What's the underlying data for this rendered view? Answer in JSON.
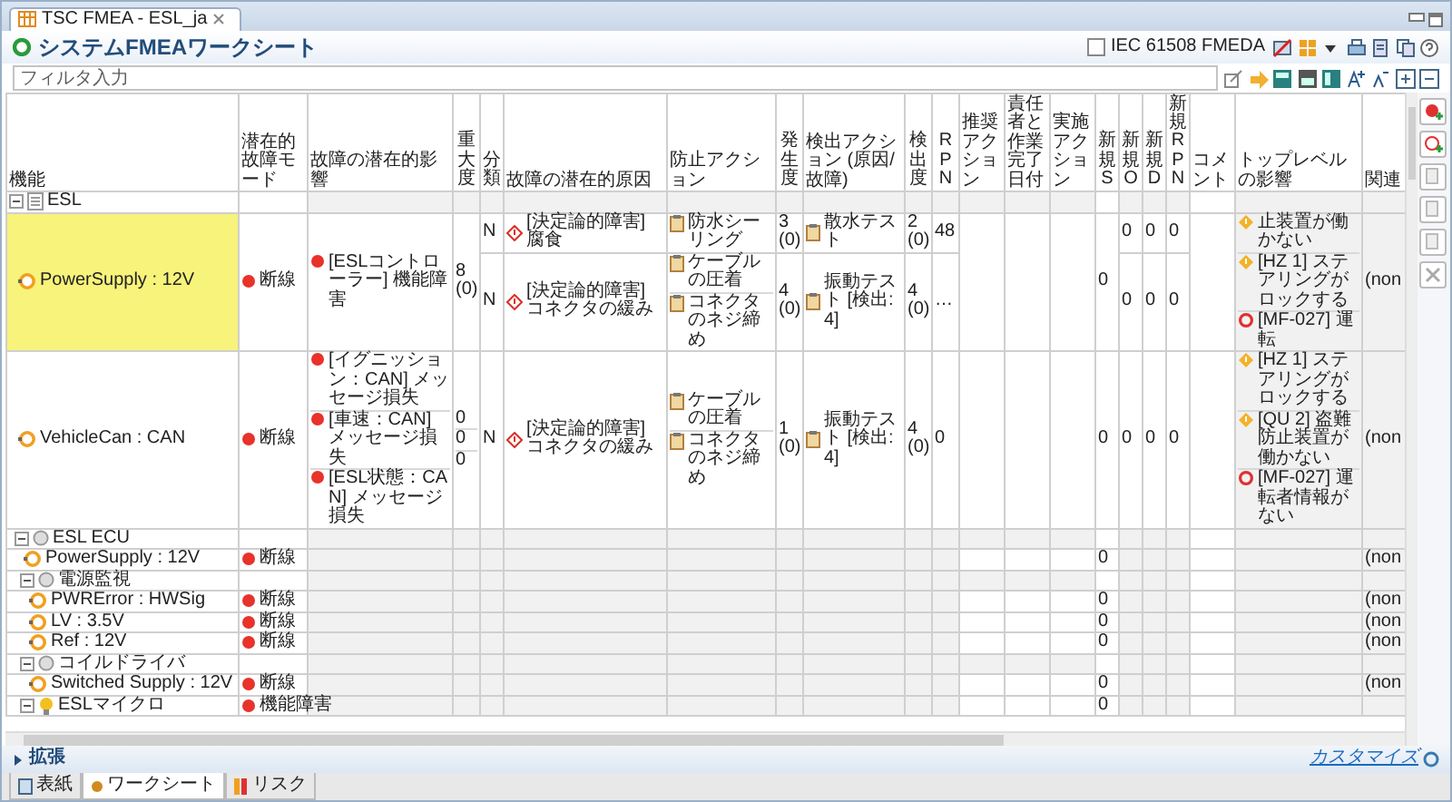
{
  "window": {
    "tab_title": "TSC FMEA - ESL_ja"
  },
  "header": {
    "title": "システムFMEAワークシート",
    "fmeda_checkbox": {
      "label": "IEC 61508 FMEDA",
      "checked": false
    }
  },
  "filter": {
    "placeholder": "フィルタ入力"
  },
  "table": {
    "columns": [
      {
        "label": "機能",
        "kind": "h"
      },
      {
        "label": "潜在的故障モード",
        "kind": "h"
      },
      {
        "label": "故障の潜在的影響",
        "kind": "h"
      },
      {
        "label": "重大度",
        "kind": "v"
      },
      {
        "label": "分類",
        "kind": "v"
      },
      {
        "label": "故障の潜在的原因",
        "kind": "h"
      },
      {
        "label": "防止アクション",
        "kind": "h"
      },
      {
        "label": "発生度",
        "kind": "v"
      },
      {
        "label": "検出アクション (原因/故障)",
        "kind": "h"
      },
      {
        "label": "検出度",
        "kind": "v"
      },
      {
        "label": "RPN",
        "kind": "v"
      },
      {
        "label": "推奨アクション",
        "kind": "h"
      },
      {
        "label": "責任者と作業完了日付",
        "kind": "h"
      },
      {
        "label": "実施アクション",
        "kind": "h"
      },
      {
        "label": "新規S",
        "kind": "v"
      },
      {
        "label": "新規O",
        "kind": "v"
      },
      {
        "label": "新規D",
        "kind": "v"
      },
      {
        "label": "新規RPN",
        "kind": "v"
      },
      {
        "label": "コメント",
        "kind": "h"
      },
      {
        "label": "トップレベルの影響",
        "kind": "h"
      },
      {
        "label": "関連",
        "kind": "h"
      }
    ],
    "rows": [
      {
        "function": "ESL",
        "kind": "system",
        "selected": false,
        "expanded": true,
        "children": [
          {
            "function": "PowerSupply : 12V",
            "kind": "port",
            "selected": true,
            "mode": "断線",
            "effects": [
              {
                "text": "[ESLコントローラー] 機能障害",
                "severity": "8 (0)"
              }
            ],
            "causes": [
              {
                "class": "N",
                "text": "[決定論的障害] 腐食",
                "prevention": [
                  "防水シーリング"
                ],
                "occurrence": "3 (0)",
                "detection": "散水テスト",
                "det_rating": "2 (0)",
                "rpn": "48",
                "new_o": "0",
                "new_d": "0",
                "new_rpn": "0"
              },
              {
                "class": "N",
                "text": "[決定論的障害] コネクタの緩み",
                "prevention": [
                  "ケーブルの圧着",
                  "コネクタのネジ締め"
                ],
                "occurrence": "4 (0)",
                "detection": "振動テスト [検出: 4]",
                "det_rating": "4 (0)",
                "rpn": "…",
                "new_o": "0",
                "new_d": "0",
                "new_rpn": "0"
              }
            ],
            "new_s": "0",
            "top_effects": [
              {
                "text": "止装置が働かない",
                "kind": "hazard"
              },
              {
                "text": "[HZ 1] ステアリングがロックする",
                "kind": "hazard"
              },
              {
                "text": "[MF-027] 運転",
                "kind": "malfunction"
              }
            ],
            "related": "(non"
          },
          {
            "function": "VehicleCan : CAN",
            "kind": "port",
            "selected": false,
            "mode": "断線",
            "effects": [
              {
                "text": "[イグニッション：CAN] メッセージ損失",
                "severity": "0"
              },
              {
                "text": "[車速：CAN] メッセージ損失",
                "severity": "0"
              },
              {
                "text": "[ESL状態：CAN] メッセージ損失",
                "severity": "0"
              }
            ],
            "causes": [
              {
                "class": "N",
                "text": "[決定論的障害] コネクタの緩み",
                "prevention": [
                  "ケーブルの圧着",
                  "コネクタのネジ締め"
                ],
                "occurrence": "1 (0)",
                "detection": "振動テスト [検出: 4]",
                "det_rating": "4 (0)",
                "rpn": "0",
                "new_o": "0",
                "new_d": "0",
                "new_rpn": "0"
              }
            ],
            "new_s": "0",
            "top_effects": [
              {
                "text": "[HZ 1] ステアリングがロックする",
                "kind": "hazard"
              },
              {
                "text": "[QU 2] 盗難防止装置が働かない",
                "kind": "hazard"
              },
              {
                "text": "[MF-027] 運転者情報がない",
                "kind": "malfunction"
              }
            ],
            "related": "(non"
          },
          {
            "function": "ESL ECU",
            "kind": "block",
            "selected": false,
            "expanded": true,
            "children": [
              {
                "function": "PowerSupply : 12V",
                "kind": "port",
                "selected": false,
                "mode": "断線",
                "new_s": "0",
                "related": "(non"
              },
              {
                "function": "電源監視",
                "kind": "block",
                "selected": false,
                "expanded": true,
                "children": [
                  {
                    "function": "PWRError : HWSig",
                    "kind": "port",
                    "selected": false,
                    "mode": "断線",
                    "new_s": "0",
                    "related": "(non"
                  },
                  {
                    "function": "LV : 3.5V",
                    "kind": "port",
                    "selected": false,
                    "mode": "断線",
                    "new_s": "0",
                    "related": "(non"
                  },
                  {
                    "function": "Ref : 12V",
                    "kind": "port",
                    "selected": false,
                    "mode": "断線",
                    "new_s": "0",
                    "related": "(non"
                  }
                ]
              },
              {
                "function": "コイルドライバ",
                "kind": "block",
                "selected": false,
                "expanded": true,
                "children": [
                  {
                    "function": "Switched Supply : 12V",
                    "kind": "port",
                    "selected": false,
                    "mode": "断線",
                    "new_s": "0",
                    "related": "(non"
                  }
                ]
              },
              {
                "function": "ESLマイクロ",
                "kind": "micro",
                "selected": false,
                "expanded": true,
                "mode": "機能障害",
                "new_s": "0"
              }
            ]
          }
        ]
      }
    ]
  },
  "footer": {
    "expander": "拡張",
    "expanded": false,
    "customize_link": "カスタマイズ"
  },
  "bottom_tabs": [
    {
      "label": "表紙",
      "kind": "cover",
      "selected": false
    },
    {
      "label": "ワークシート",
      "kind": "sheet",
      "selected": true
    },
    {
      "label": "リスク",
      "kind": "risk",
      "selected": false
    }
  ]
}
